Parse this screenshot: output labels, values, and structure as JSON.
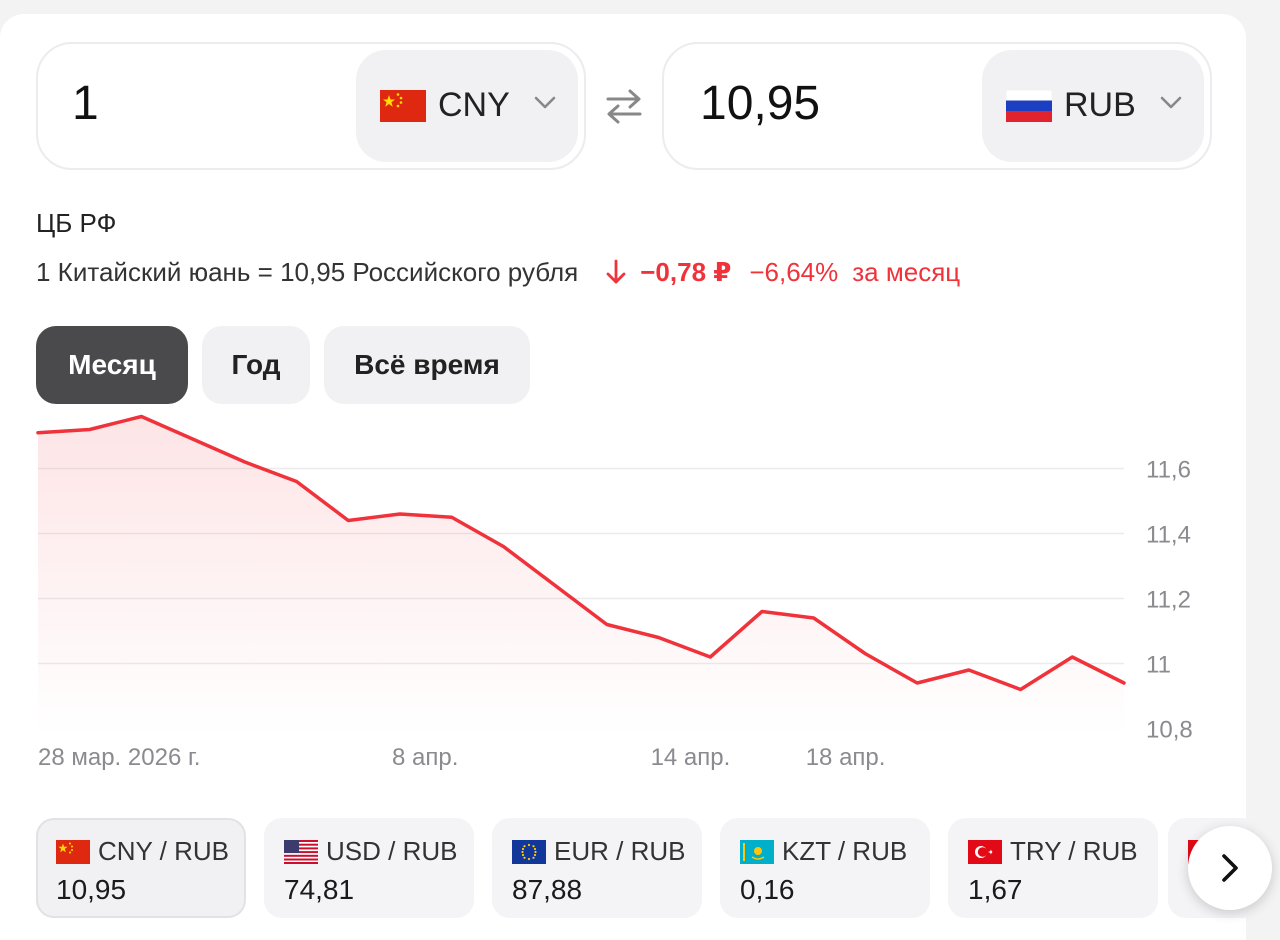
{
  "converter": {
    "from": {
      "amount": "1",
      "currency": "CNY",
      "flag": "china-flag-icon"
    },
    "to": {
      "amount": "10,95",
      "currency": "RUB",
      "flag": "russia-flag-icon"
    },
    "swap_icon": "swap-arrows-icon"
  },
  "info": {
    "source": "ЦБ РФ",
    "rate_text": "1 Китайский юань = 10,95 Российского рубля",
    "change_abs": "−0,78 ₽",
    "change_pct": "−6,64%",
    "change_period": "за месяц",
    "change_color": "#f0323b"
  },
  "period_tabs": [
    {
      "label": "Месяц",
      "active": true
    },
    {
      "label": "Год",
      "active": false
    },
    {
      "label": "Всё время",
      "active": false
    }
  ],
  "chart_data": {
    "type": "area",
    "line_color": "#f0323b",
    "x": [
      "28 мар. 2026 г.",
      "",
      "",
      "",
      "",
      "",
      "",
      "8 апр.",
      "",
      "",
      "",
      "",
      "14 апр.",
      "",
      "",
      "18 апр.",
      "",
      "",
      "",
      "",
      "",
      ""
    ],
    "values": [
      11.71,
      11.72,
      11.76,
      11.69,
      11.62,
      11.56,
      11.44,
      11.46,
      11.45,
      11.36,
      11.24,
      11.12,
      11.08,
      11.02,
      11.16,
      11.14,
      11.03,
      10.94,
      10.98,
      10.92,
      11.02,
      10.94
    ],
    "x_tick_labels": [
      "28 мар. 2026 г.",
      "8 апр.",
      "14 апр.",
      "18 апр."
    ],
    "y_tick_labels": [
      "11,6",
      "11,4",
      "11,2",
      "11",
      "10,8"
    ],
    "y_ticks": [
      11.6,
      11.4,
      11.2,
      11.0,
      10.8
    ],
    "ylim": [
      10.78,
      11.78
    ],
    "grid": true,
    "y_axis_position": "right"
  },
  "pairs": [
    {
      "name": "CNY / RUB",
      "value": "10,95",
      "flag": "china-flag-icon",
      "active": true
    },
    {
      "name": "USD / RUB",
      "value": "74,81",
      "flag": "usa-flag-icon",
      "active": false
    },
    {
      "name": "EUR / RUB",
      "value": "87,88",
      "flag": "eu-flag-icon",
      "active": false
    },
    {
      "name": "KZT / RUB",
      "value": "0,16",
      "flag": "kazakhstan-flag-icon",
      "active": false
    },
    {
      "name": "TRY / RUB",
      "value": "1,67",
      "flag": "turkey-flag-icon",
      "active": false
    }
  ],
  "next_icon": "chevron-right-icon"
}
